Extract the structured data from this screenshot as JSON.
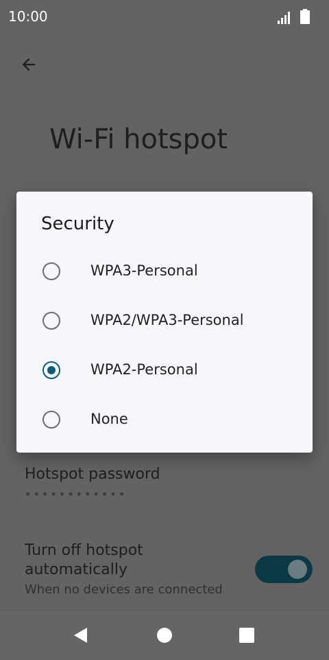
{
  "status_bar": {
    "time": "10:00"
  },
  "page": {
    "title": "Wi-Fi hotspot"
  },
  "settings": {
    "password_label": "Hotspot password",
    "password_value": "••••••••••••",
    "auto_off_title": "Turn off hotspot automatically",
    "auto_off_subtitle": "When no devices are connected",
    "auto_off_enabled": true
  },
  "dialog": {
    "title": "Security",
    "options": [
      {
        "label": "WPA3-Personal",
        "selected": false
      },
      {
        "label": "WPA2/WPA3-Personal",
        "selected": false
      },
      {
        "label": "WPA2-Personal",
        "selected": true
      },
      {
        "label": "None",
        "selected": false
      }
    ]
  },
  "colors": {
    "accent": "#0b5e79",
    "toggle_track": "#0b3a44",
    "scrim": "#636363"
  },
  "icons": {
    "back": "arrow-back-icon",
    "signal": "signal-icon",
    "battery": "battery-icon",
    "nav_back": "nav-back-icon",
    "nav_home": "nav-home-icon",
    "nav_recents": "nav-recents-icon"
  }
}
